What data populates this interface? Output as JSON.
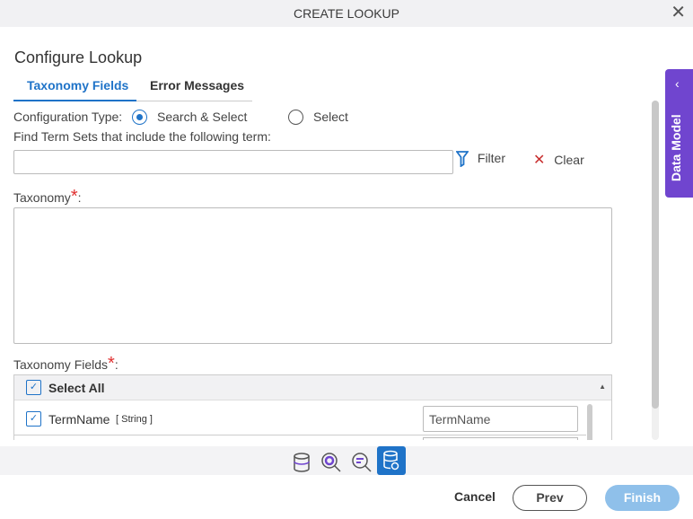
{
  "window": {
    "title": "CREATE LOOKUP"
  },
  "page": {
    "heading": "Configure Lookup"
  },
  "tabs": [
    {
      "label": "Taxonomy Fields",
      "active": true
    },
    {
      "label": "Error Messages",
      "active": false
    }
  ],
  "config": {
    "label": "Configuration Type:",
    "options": [
      {
        "label": "Search & Select",
        "selected": true
      },
      {
        "label": "Select",
        "selected": false
      }
    ]
  },
  "find": {
    "label": "Find Term Sets that include the following term:",
    "value": "",
    "filter_label": "Filter",
    "clear_label": "Clear"
  },
  "taxonomy": {
    "label": "Taxonomy",
    "required_mark": "*",
    "suffix": ":"
  },
  "taxonomy_fields": {
    "label": "Taxonomy Fields",
    "required_mark": "*",
    "suffix": ":",
    "select_all": "Select All",
    "rows": [
      {
        "name": "TermName",
        "type": "[ String ]",
        "checked": true,
        "value": "TermName"
      }
    ]
  },
  "side_panel": {
    "label": "Data Model"
  },
  "toolbar": {
    "icons": [
      "database-icon",
      "search-settings-icon",
      "search-filter-icon",
      "database-settings-icon"
    ],
    "active": "database-settings-icon"
  },
  "footer": {
    "cancel": "Cancel",
    "prev": "Prev",
    "finish": "Finish"
  },
  "colors": {
    "accent": "#1f73c8",
    "side_panel": "#7045cf",
    "finish_disabled": "#8fc0ea"
  }
}
